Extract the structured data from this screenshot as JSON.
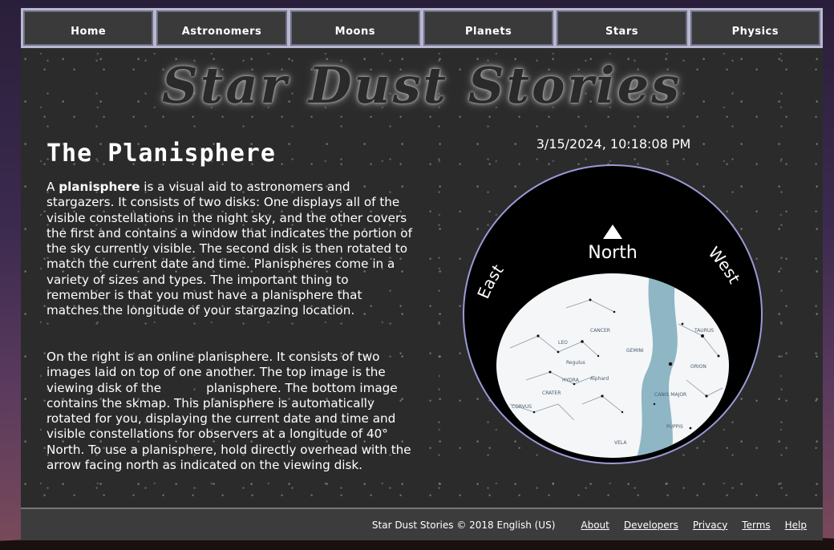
{
  "nav": {
    "items": [
      {
        "label": "Home"
      },
      {
        "label": "Astronomers"
      },
      {
        "label": "Moons"
      },
      {
        "label": "Planets"
      },
      {
        "label": "Stars"
      },
      {
        "label": "Physics"
      }
    ]
  },
  "site": {
    "title": "Star Dust Stories"
  },
  "page": {
    "heading": "The Planisphere",
    "p1_a": "A ",
    "p1_bold": "planisphere",
    "p1_b": " is a visual aid to astronomers and stargazers. It consists of two disks: One displays all of the visible constellations in the night sky, and the other covers the first and contains a window that indicates the portion of the sky currently visible. The second disk is then rotated to match the current date and time. Planispheres come in a variety of sizes and types. The important thing to remember is that you must have a planisphere that matches the longitude of your stargazing location.",
    "p2_a": "On the right is an online planisphere. It consists of two images laid on top of one another. The top image is the viewing disk of the",
    "p2_b": "planisphere. The bottom image contains the skmap. This planisphere is automatically rotated for you, displaying the current date and time and visible constellations for observers at a longitude of 40° North. To use a planisphere, hold directly overhead with the arrow facing north as indicated on the viewing disk."
  },
  "clock": {
    "datetime": "3/15/2024, 10:18:08 PM"
  },
  "planisphere": {
    "north_label": "North",
    "east_label": "East",
    "west_label": "West",
    "constellation_labels": [
      "CANCER",
      "LEO",
      "HYDRA",
      "CRATER",
      "CORVUS",
      "VELA",
      "PUPPIS",
      "GEMINI",
      "CANIS MAJOR",
      "ORION",
      "TAURUS",
      "Alphard",
      "Regulus"
    ]
  },
  "footer": {
    "copyright": "Star Dust Stories © 2018 English (US)",
    "links": [
      {
        "label": "About"
      },
      {
        "label": "Developers"
      },
      {
        "label": "Privacy"
      },
      {
        "label": "Terms"
      },
      {
        "label": "Help"
      }
    ]
  }
}
